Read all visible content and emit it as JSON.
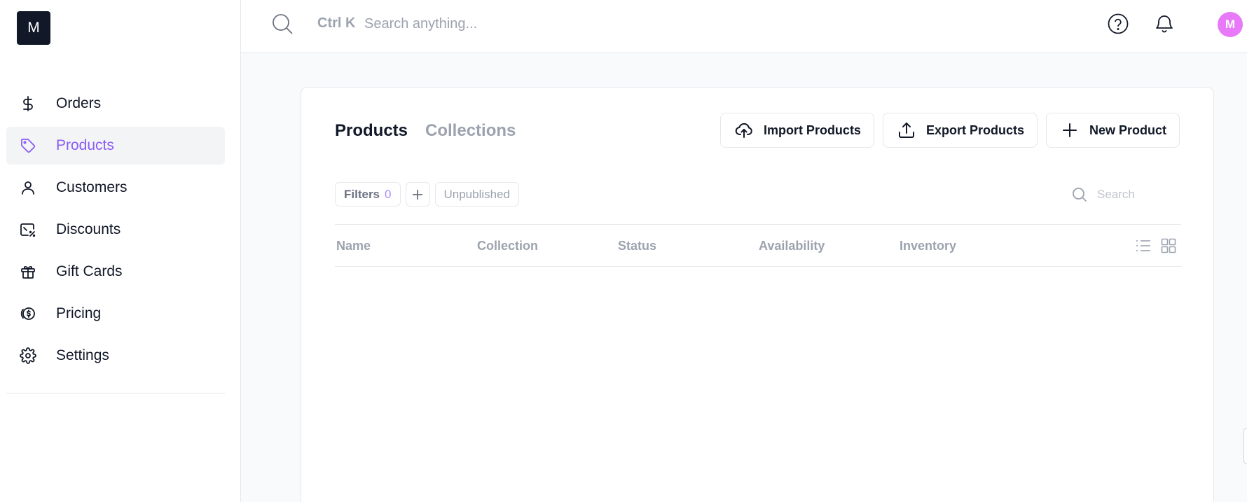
{
  "app": {
    "logo_letter": "M"
  },
  "sidebar": {
    "items": [
      {
        "label": "Orders",
        "icon": "dollar-icon",
        "active": false
      },
      {
        "label": "Products",
        "icon": "tag-icon",
        "active": true
      },
      {
        "label": "Customers",
        "icon": "user-icon",
        "active": false
      },
      {
        "label": "Discounts",
        "icon": "discount-icon",
        "active": false
      },
      {
        "label": "Gift Cards",
        "icon": "gift-icon",
        "active": false
      },
      {
        "label": "Pricing",
        "icon": "coin-icon",
        "active": false
      },
      {
        "label": "Settings",
        "icon": "gear-icon",
        "active": false
      }
    ]
  },
  "topbar": {
    "shortcut": "Ctrl K",
    "search_placeholder": "Search anything...",
    "avatar_initial": "M"
  },
  "main": {
    "tabs": [
      {
        "label": "Products",
        "active": true
      },
      {
        "label": "Collections",
        "active": false
      }
    ],
    "actions": {
      "import_label": "Import Products",
      "export_label": "Export Products",
      "new_label": "New Product"
    },
    "filters": {
      "label": "Filters",
      "count": "0",
      "chip_label": "Unpublished"
    },
    "search_placeholder": "Search",
    "columns": [
      "Name",
      "Collection",
      "Status",
      "Availability",
      "Inventory"
    ]
  },
  "colors": {
    "accent": "#8b5cf6",
    "avatar": "#e879f9",
    "logo_bg": "#111827"
  }
}
